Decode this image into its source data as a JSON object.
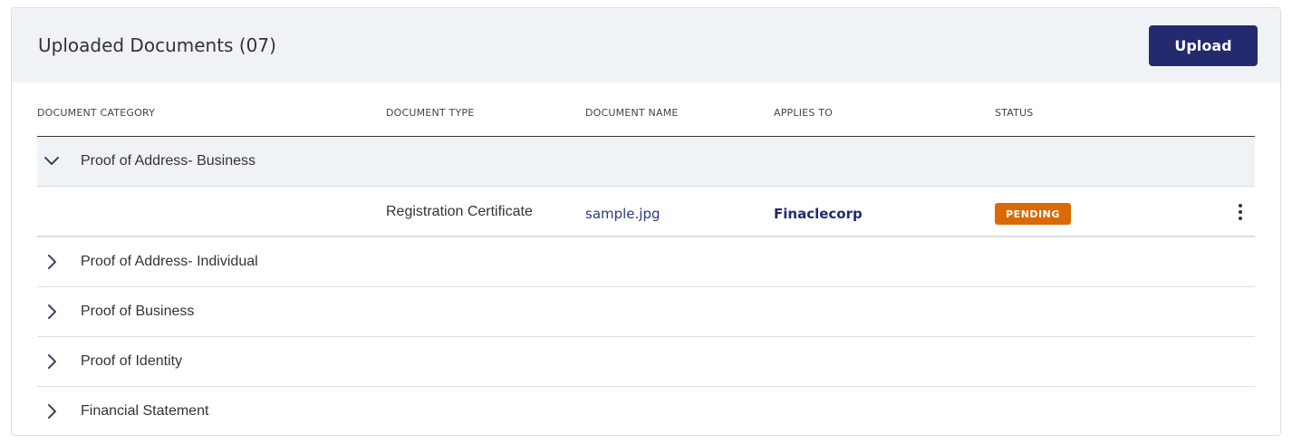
{
  "header": {
    "title": "Uploaded Documents (07)",
    "upload_label": "Upload"
  },
  "columns": {
    "category": "DOCUMENT CATEGORY",
    "type": "DOCUMENT TYPE",
    "name": "DOCUMENT NAME",
    "applies": "APPLIES TO",
    "status": "STATUS"
  },
  "groups": [
    {
      "label": "Proof of Address- Business",
      "expanded": true,
      "documents": [
        {
          "type": "Registration Certificate",
          "name": "sample.jpg",
          "applies_to": "Finaclecorp",
          "status": "PENDING"
        }
      ]
    },
    {
      "label": "Proof of Address- Individual",
      "expanded": false
    },
    {
      "label": "Proof of Business",
      "expanded": false
    },
    {
      "label": "Proof of Identity",
      "expanded": false
    },
    {
      "label": "Financial Statement",
      "expanded": false
    }
  ],
  "colors": {
    "primary": "#232a6e",
    "pending": "#d96a06",
    "header_bg": "#f0f3f6",
    "link": "#2f3a80"
  },
  "icons": {
    "expanded": "chevron-down-icon",
    "collapsed": "chevron-right-icon",
    "row_menu": "more-vertical-icon"
  }
}
